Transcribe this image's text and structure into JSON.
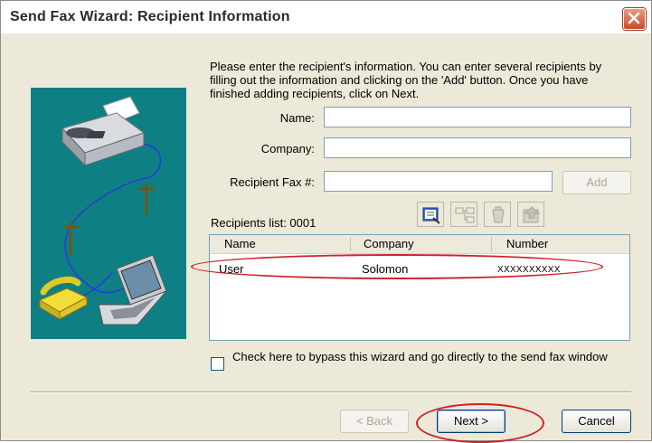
{
  "window": {
    "title": "Send Fax Wizard: Recipient Information"
  },
  "intro_text": "Please enter the recipient's information. You can enter several recipients by filling out the information and clicking on the 'Add' button. Once you have finished adding recipients, click on Next.",
  "form": {
    "name_label": "Name:",
    "name_value": "",
    "company_label": "Company:",
    "company_value": "",
    "fax_label": "Recipient Fax #:",
    "fax_value": "",
    "add_label": "Add"
  },
  "recipients": {
    "label": "Recipients list: 0001",
    "columns": [
      "Name",
      "Company",
      "Number"
    ],
    "rows": [
      {
        "name": "User",
        "company": "Solomon",
        "number": "XXXXXXXXXX"
      }
    ]
  },
  "checkbox": {
    "label": "Check here to bypass this wizard and go directly to the send fax window",
    "checked": false
  },
  "buttons": {
    "back": "< Back",
    "next": "Next >",
    "cancel": "Cancel"
  },
  "icons": [
    "address-book-icon",
    "distribution-list-icon",
    "delete-icon",
    "save-contact-icon",
    "close-icon"
  ],
  "colors": {
    "illustration_bg": "#0e8083",
    "highlight": "#d0202a",
    "window_bg": "#ece9d8"
  }
}
